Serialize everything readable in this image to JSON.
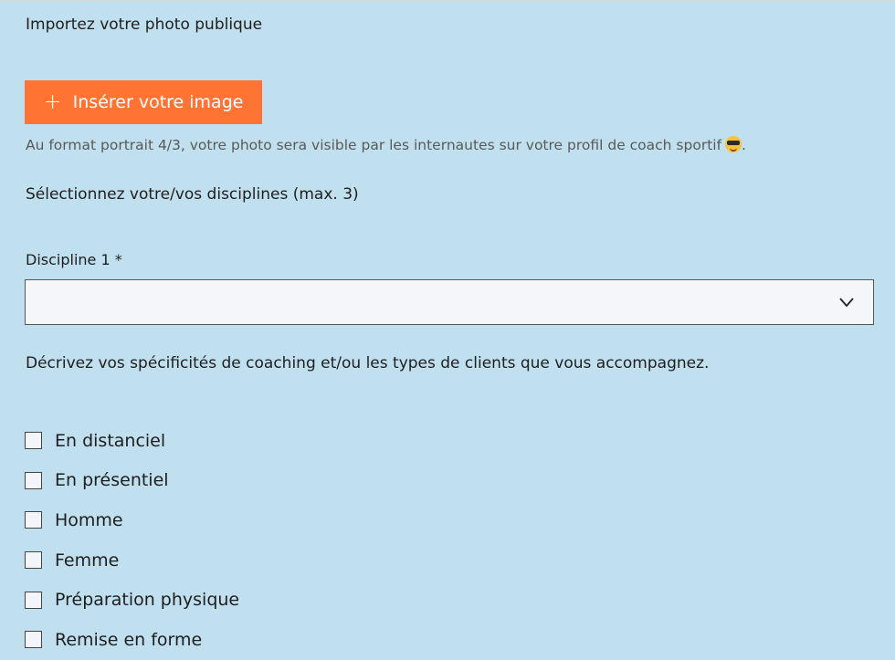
{
  "photo": {
    "label": "Importez votre photo publique",
    "button_icon": "+",
    "button_label": "Insérer votre image",
    "help_text": "Au format portrait 4/3, votre photo sera visible par les internautes sur votre profil de coach sportif",
    "help_emoji": "smiling-face-with-sunglasses",
    "help_suffix": "."
  },
  "disciplines": {
    "label": "Sélectionnez votre/vos disciplines (max. 3)",
    "field_label": "Discipline 1 *",
    "selected_value": ""
  },
  "specifics": {
    "label": "Décrivez vos spécificités de coaching et/ou les types de clients que vous accompagnez.",
    "options": [
      {
        "label": "En distanciel",
        "checked": false
      },
      {
        "label": "En présentiel",
        "checked": false
      },
      {
        "label": "Homme",
        "checked": false
      },
      {
        "label": "Femme",
        "checked": false
      },
      {
        "label": "Préparation physique",
        "checked": false
      },
      {
        "label": "Remise en forme",
        "checked": false
      }
    ]
  },
  "colors": {
    "background": "#c1e0ef",
    "accent": "#ff7433"
  }
}
